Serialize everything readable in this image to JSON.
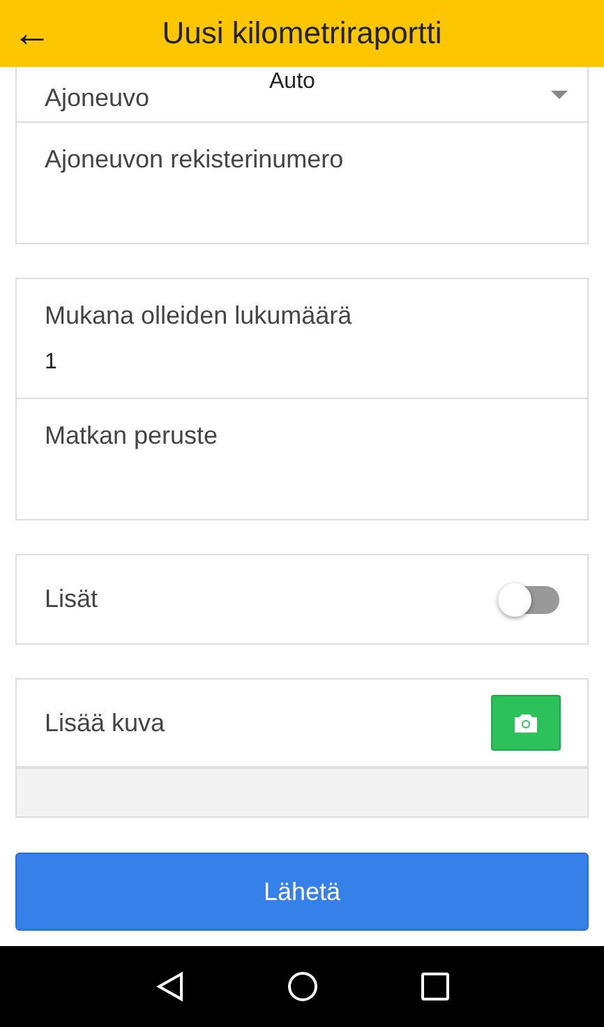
{
  "header": {
    "back_icon": "←",
    "title": "Uusi kilometriraportti"
  },
  "groups": [
    {
      "fields": [
        {
          "kind": "select",
          "label": "Ajoneuvo",
          "value": "Auto"
        },
        {
          "kind": "text",
          "label": "Ajoneuvon rekisterinumero"
        }
      ]
    },
    {
      "fields": [
        {
          "kind": "text",
          "label": "Mukana olleiden lukumäärä",
          "value": "1"
        },
        {
          "kind": "text",
          "label": "Matkan peruste"
        }
      ]
    },
    {
      "fields": [
        {
          "kind": "toggle",
          "label": "Lisät",
          "on": false
        }
      ]
    },
    {
      "fields": [
        {
          "kind": "photo",
          "label": "Lisää kuva"
        },
        {
          "kind": "blank"
        }
      ]
    }
  ],
  "submit": "Lähetä"
}
